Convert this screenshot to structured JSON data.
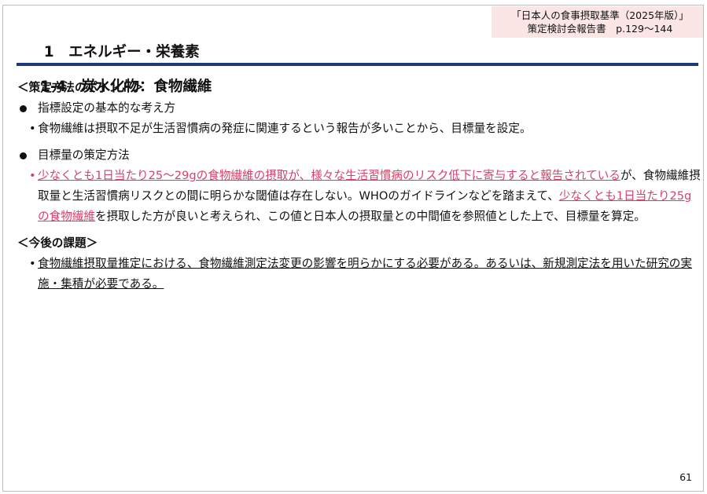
{
  "source_box": {
    "line1": "「日本人の食事摂取基準（2025年版）」",
    "line2": "策定検討会報告書　p.129〜144"
  },
  "title": {
    "line1": "1　エネルギー・栄養素",
    "line2": "1-4　炭水化物：食物繊維"
  },
  "colors": {
    "rule": "#1f3a7a",
    "accent": "#d8406a",
    "source_bg": "#fbe5e5"
  },
  "section1": {
    "heading": "＜策定方法のポイント＞",
    "bullet1": {
      "label": "指標設定の基本的な考え方",
      "item": "食物繊維は摂取不足が生活習慣病の発症に関連するという報告が多いことから、目標量を設定。"
    },
    "bullet2": {
      "label": "目標量の策定方法",
      "item_part1": "少なくとも1日当たり25～29gの食物繊維の摂取が、様々な生活習慣病のリスク低下に寄与すると報告されている",
      "item_part2": "が、食物繊維摂取量と生活習慣病リスクとの間に明らかな閾値は存在しない。WHOのガイドラインなどを踏まえて、",
      "item_part3": "少なくとも1日当たり25gの食物繊維",
      "item_part4": "を摂取した方が良いと考えられ、この値と日本人の摂取量との中間値を参照値とした上で、目標量を算定。"
    }
  },
  "section2": {
    "heading": "＜今後の課題＞",
    "item": "食物繊維摂取量推定における、食物繊維測定法変更の影響を明らかにする必要がある。あるいは、新規測定法を用いた研究の実施・集積が必要である。"
  },
  "page_number": "61"
}
